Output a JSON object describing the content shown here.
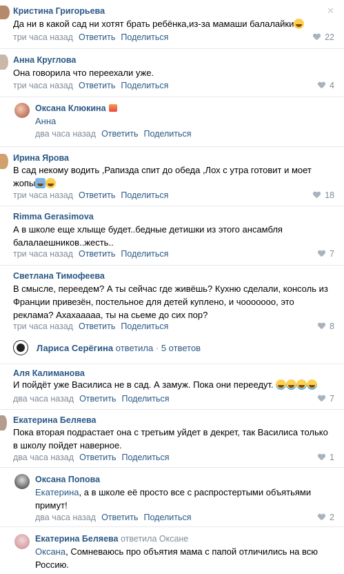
{
  "comments": [
    {
      "author": "Кристина Григорьева",
      "text": "Да ни в какой сад ни хотят брать ребёнка,из-за мамаши балалайки",
      "time": "три часа назад",
      "reply": "Ответить",
      "share": "Поделиться",
      "likes": "22",
      "close": "✕"
    },
    {
      "author": "Анна Круглова",
      "text": "Она говорила что переехали уже.",
      "time": "три часа назад",
      "reply": "Ответить",
      "share": "Поделиться",
      "likes": "4"
    },
    {
      "author": "Оксана Клюкина",
      "mention": "Анна",
      "time": "два часа назад",
      "reply": "Ответить",
      "share": "Поделиться"
    },
    {
      "author": "Ирина Ярова",
      "text_line1": "В сад некому водить ,Рапизда спит до обеда ,Лох с утра готовит и моет",
      "text_line2": "жопы",
      "time": "три часа назад",
      "reply": "Ответить",
      "share": "Поделиться",
      "likes": "18"
    },
    {
      "author": "Rimma Gerasimova",
      "text_line1": "А в школе еще хлыще будет..бедные детишки из этого ансамбля",
      "text_line2": "балалаешников..жесть..",
      "time": "три часа назад",
      "reply": "Ответить",
      "share": "Поделиться",
      "likes": "7"
    },
    {
      "author": "Светлана Тимофеева",
      "text_line1": "В смысле, переедем? А ты сейчас где живёшь? Кухню сделали, консоль из",
      "text_line2": "Франции привезён, постельное для детей куплено, и чоооoooo, это",
      "text_line3": "реклама? Ахахааааа, ты на сьеме до сих пор?",
      "time": "три часа назад",
      "reply": "Ответить",
      "share": "Поделиться",
      "likes": "8"
    },
    {
      "thread_author": "Лариса Серёгина",
      "thread_replied": "ответила",
      "thread_dot": "·",
      "thread_count": "5 ответов"
    },
    {
      "author": "Аля Калиманова",
      "text": "И пойдёт уже Василиса не в сад. А замуж. Пока они переедут.",
      "time": "два часа назад",
      "reply": "Ответить",
      "share": "Поделиться",
      "likes": "7"
    },
    {
      "author": "Екатерина Беляева",
      "text_line1": "Пока вторая подрастает она с третьим уйдет в декрет, так Василиса только",
      "text_line2": "в школу пойдет наверное.",
      "time": "два часа назад",
      "reply": "Ответить",
      "share": "Поделиться",
      "likes": "1"
    },
    {
      "author": "Оксана Попова",
      "mention": "Екатерина",
      "text_line1": ", а в школе её просто все с распростертыми объятьями",
      "text_line2": "примут!",
      "time": "два часа назад",
      "reply": "Ответить",
      "share": "Поделиться",
      "likes": "2"
    },
    {
      "author": "Екатерина Беляева",
      "replied_to": "ответила Оксане",
      "mention": "Оксана",
      "text_line1": ", Сомневаюсь про объятия мама с папой отличились на всю",
      "text_line2": "Россию."
    }
  ]
}
